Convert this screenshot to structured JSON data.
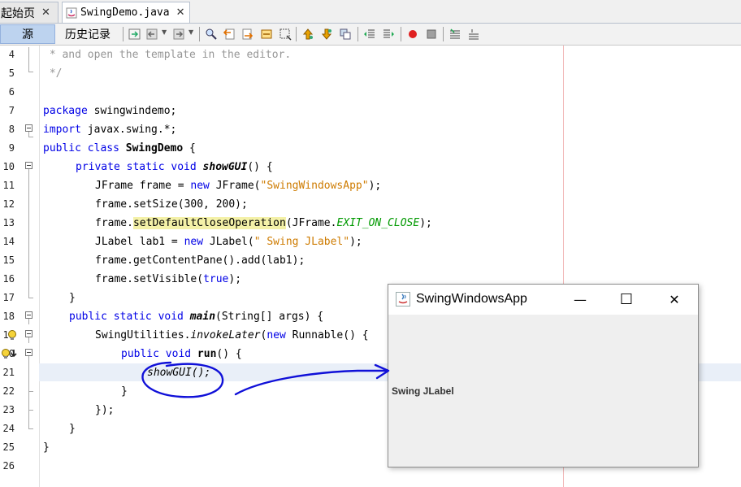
{
  "tabs": [
    {
      "label": "起始页",
      "close": "✕"
    },
    {
      "label": "SwingDemo.java",
      "close": "✕"
    }
  ],
  "toolbar": {
    "source_label": "源",
    "history_label": "历史记录"
  },
  "editor": {
    "lines": [
      {
        "num": "4"
      },
      {
        "num": "5"
      },
      {
        "num": "6"
      },
      {
        "num": "7"
      },
      {
        "num": "8"
      },
      {
        "num": "9"
      },
      {
        "num": "10"
      },
      {
        "num": "11"
      },
      {
        "num": "12"
      },
      {
        "num": "13"
      },
      {
        "num": "14"
      },
      {
        "num": "15"
      },
      {
        "num": "16"
      },
      {
        "num": "17"
      },
      {
        "num": "18"
      },
      {
        "num": "19"
      },
      {
        "num": "20"
      },
      {
        "num": "21"
      },
      {
        "num": "22"
      },
      {
        "num": "23"
      },
      {
        "num": "24"
      },
      {
        "num": "25"
      },
      {
        "num": "26"
      }
    ],
    "code": {
      "l4": " * and open the template in the editor.",
      "l5": " */",
      "l7_kw": "package",
      "l7_rest": " swingwindemo;",
      "l8_kw": "import",
      "l8_rest": " javax.swing.*;",
      "l9_kw": "public class",
      "l9_name": "SwingDemo",
      "l9_rest": " {",
      "l10_kw": "private static void",
      "l10_name": "showGUI",
      "l10_rest": "() {",
      "l11_a": "JFrame frame = ",
      "l11_kw": "new",
      "l11_b": " JFrame(",
      "l11_str": "\"SwingWindowsApp\"",
      "l11_c": ");",
      "l12": "frame.setSize(300, 200);",
      "l13_a": "frame.",
      "l13_mark": "setDefaultCloseOperation",
      "l13_b": "(JFrame.",
      "l13_const": "EXIT_ON_CLOSE",
      "l13_c": ");",
      "l14_a": "JLabel lab1 = ",
      "l14_kw": "new",
      "l14_b": " JLabel(",
      "l14_str": "\" Swing JLabel\"",
      "l14_c": ");",
      "l15": "frame.getContentPane().add(lab1);",
      "l16_a": "frame.setVisible(",
      "l16_kw": "true",
      "l16_b": ");",
      "l17": "}",
      "l18_kw": "public static void",
      "l18_name": "main",
      "l18_rest": "(String[] args) {",
      "l19_a": "SwingUtilities.",
      "l19_it": "invokeLater",
      "l19_b": "(",
      "l19_kw": "new",
      "l19_c": " Runnable() {",
      "l20_kw": "public void",
      "l20_name": "run",
      "l20_rest": "() {",
      "l21": "showGUI();",
      "l22": "}",
      "l23": "});",
      "l24": "}",
      "l25": "}"
    }
  },
  "popup": {
    "title": "SwingWindowsApp",
    "minimize": "—",
    "maximize": "☐",
    "close": "✕",
    "label": "Swing JLabel"
  },
  "colors": {
    "keyword": "#0000e6",
    "comment": "#969696",
    "string": "#ce7b00",
    "annotation_ink": "#1010d8"
  }
}
